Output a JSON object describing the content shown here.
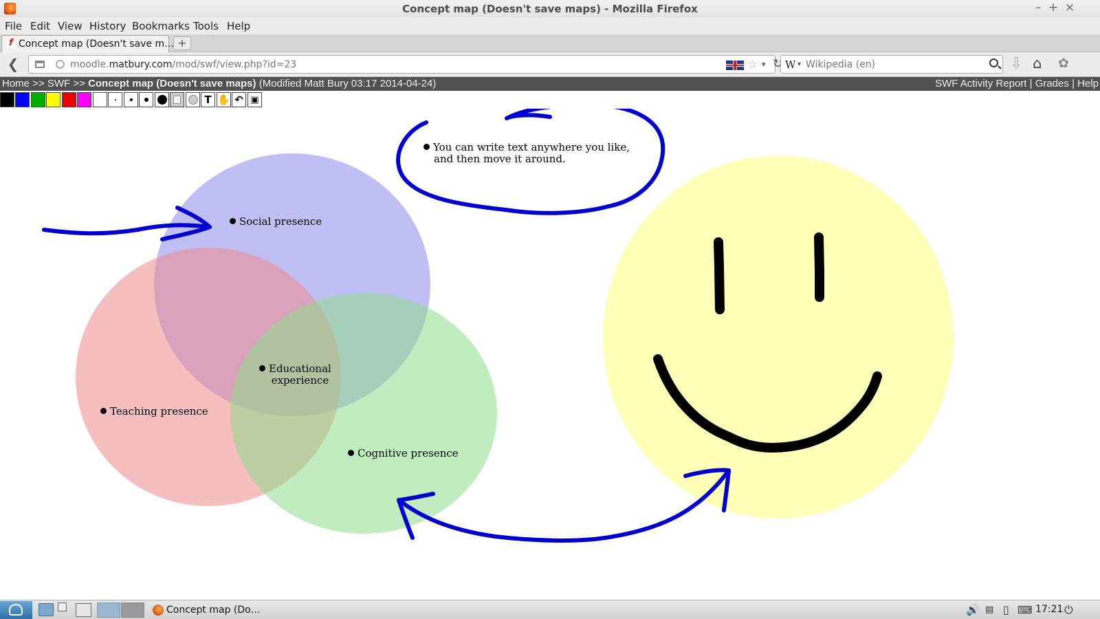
{
  "window": {
    "title": "Concept map (Doesn't save maps) - Mozilla Firefox",
    "minimize": "–",
    "maximize": "+",
    "close": "×"
  },
  "menu": {
    "items": [
      "File",
      "Edit",
      "View",
      "History",
      "Bookmarks",
      "Tools",
      "Help"
    ]
  },
  "tabs": [
    {
      "label": "Concept map (Doesn't save m…",
      "active": true
    }
  ],
  "newtab_label": "+",
  "nav": {
    "url_prefix": "moodle.",
    "url_domain": "matbury.com",
    "url_path": "/mod/swf/view.php?id=23",
    "search_engine": "W",
    "search_placeholder": "Wikipedia (en)"
  },
  "breadcrumb": {
    "home": "Home",
    "sep1": " >> ",
    "swf": "SWF",
    "sep2": " >> ",
    "current": "Concept map (Doesn't save maps)",
    "modified": " (Modified Matt Bury 03:17 2014-04-24)",
    "links": [
      "SWF Activity Report",
      "Grades",
      "Help"
    ],
    "link_sep": " | "
  },
  "swf_toolbar": {
    "colors": [
      "#000000",
      "#0000ff",
      "#00b000",
      "#ffff00",
      "#ee0000",
      "#ff00ff",
      "#ffffff"
    ],
    "brush_sizes": [
      2,
      4,
      6,
      10,
      14
    ],
    "tools": [
      "eraser-tool",
      "circle-tool",
      "text-tool",
      "hand-tool",
      "undo-tool",
      "camera-tool"
    ],
    "text_glyph": "T"
  },
  "canvas": {
    "notes": {
      "speech": [
        "You can write text anywhere you like,",
        "and then move it around."
      ],
      "social": "Social presence",
      "teaching": "Teaching presence",
      "cognitive": "Cognitive presence",
      "educational": [
        "Educational",
        "experience"
      ]
    },
    "circle_colors": {
      "social": "#9a98ee",
      "teaching": "#ee8a8a",
      "cognitive": "#8edc8a",
      "smiley": "#ffffb8"
    },
    "ink_colors": {
      "blue": "#0000d0",
      "black": "#000000"
    }
  },
  "taskbar": {
    "window_label": "Concept map (Do…",
    "clock": "17:21"
  }
}
